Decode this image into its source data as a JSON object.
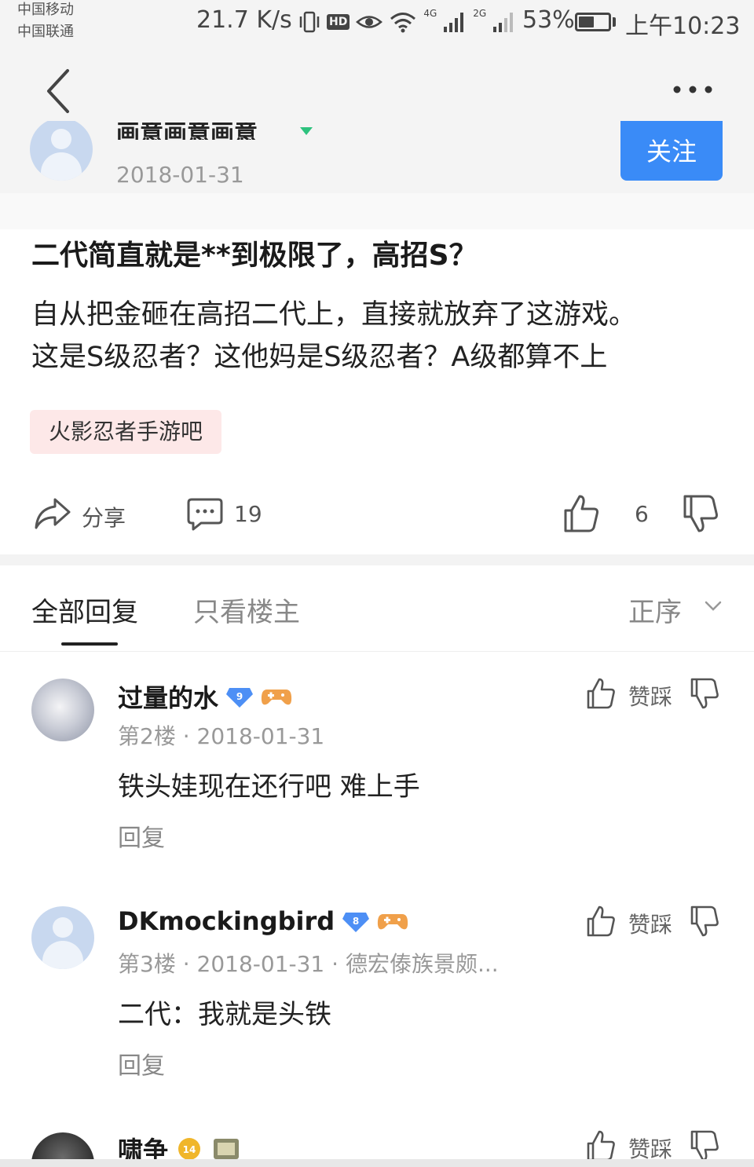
{
  "status_bar": {
    "carrier_1": "中国移动",
    "carrier_2": "中国联通",
    "net_speed": "21.7 K/s",
    "hd": "HD",
    "signal_1_label": "4G",
    "signal_2_label": "2G",
    "battery_pct": "53%",
    "battery_level": 0.53,
    "time": "上午10:23"
  },
  "nav": {
    "back_icon": "chevron-left-icon",
    "more_icon": "more-dots-icon"
  },
  "author": {
    "name": "画意画意画意",
    "date": "2018-01-31",
    "follow_label": "关注"
  },
  "post": {
    "title": "二代简直就是**到极限了，高招S？",
    "body_line_1": "自从把金砸在高招二代上，直接就放弃了这游戏。",
    "body_line_2": "这是S级忍者？这他妈是S级忍者？A级都算不上",
    "forum_tag": "火影忍者手游吧"
  },
  "actions": {
    "share_label": "分享",
    "comment_count": "19",
    "like_count": "6"
  },
  "reply_tabs": {
    "all": "全部回复",
    "author_only": "只看楼主",
    "sort": "正序"
  },
  "replies": [
    {
      "name": "过量的水",
      "level": "9",
      "floor": "第2楼 · 2018-01-31",
      "text": "铁头娃现在还行吧 难上手",
      "reply_label": "回复",
      "vote_label": "赞踩"
    },
    {
      "name": "DKmockingbird",
      "level": "8",
      "floor": "第3楼 · 2018-01-31 · 德宏傣族景颇...",
      "text": "二代：我就是头铁",
      "reply_label": "回复",
      "vote_label": "赞踩"
    },
    {
      "name": "啸争",
      "level": "14",
      "vote_label": "赞踩"
    }
  ],
  "colors": {
    "accent_blue": "#3a8bf7",
    "tag_bg": "#fde8e8",
    "badge_blue": "#4d8ff5",
    "badge_gold": "#f0b62b"
  }
}
